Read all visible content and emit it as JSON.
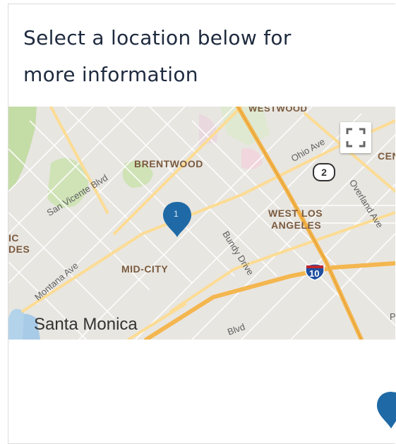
{
  "prompt": {
    "text_line1": "Select a location below for",
    "text_line2": "more information"
  },
  "map": {
    "districts": {
      "brentwood": "BRENTWOOD",
      "west_los_angeles_1": "WEST LOS",
      "west_los_angeles_2": "ANGELES",
      "mid_city": "MID-CITY",
      "wood_top": "WESTWOOD",
      "cen_edge": "CEN",
      "ic_edge": "IC",
      "des_edge": "DES"
    },
    "streets": {
      "ohio_ave": "Ohio Ave",
      "san_vicente": "San Vicente Blvd",
      "overland_ave": "Overland Ave",
      "bundy_drive": "Bundy Drive",
      "montana_ave": "Montana Ave",
      "blvd": "Blvd",
      "p_edge": "P"
    },
    "city": "Santa Monica",
    "highway_2": "2",
    "interstate_10": "10",
    "marker_label": "1"
  },
  "colors": {
    "marker": "#1f6aa6",
    "freeway": "#f4b64f",
    "arterial": "#fbd98a",
    "park": "#c8dfae",
    "water": "#a8cbe8",
    "text_dark": "#1e2a3e"
  },
  "icons": {
    "fullscreen": "fullscreen-icon",
    "marker": "map-pin-icon"
  }
}
